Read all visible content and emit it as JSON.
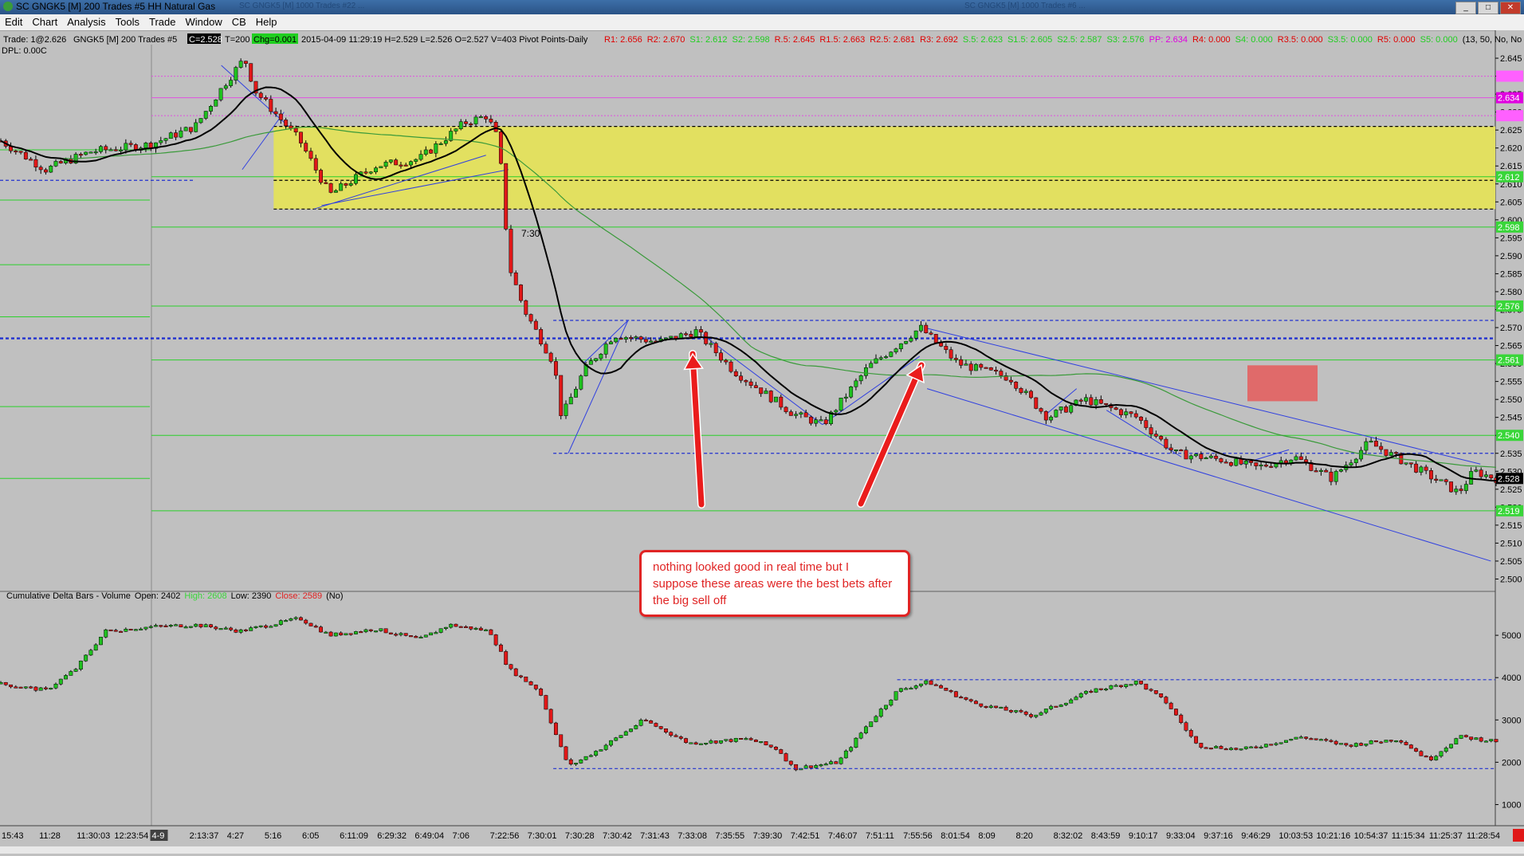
{
  "window": {
    "title": "SC GNGK5 [M]  200 Trades  #5  HH Natural Gas",
    "ghost_title_1": "SC  GNGK5 [M]  1000 Trades  #22 ...",
    "ghost_title_2": "SC  GNGK5 [M]  1000 Trades  #6 ...",
    "buttons": [
      "_",
      "□",
      "✕"
    ]
  },
  "menu": [
    "Edit",
    "Chart",
    "Analysis",
    "Tools",
    "Trade",
    "Window",
    "CB",
    "Help"
  ],
  "info_bar": {
    "trade": "Trade: 1@2.626",
    "symbol": "GNGK5 [M]  200 Trades  #5",
    "close_badge": "C=2.528",
    "t_label": "T=200",
    "chg_badge": "Chg=0.001",
    "bar_info": "2015-04-09 11:29:19 H=2.529 L=2.526 O=2.527 V=403 Pivot Points-Daily",
    "dpl": "DPL: 0.00C",
    "pivots": [
      {
        "text": "R1: 2.656",
        "color": "#e00000"
      },
      {
        "text": "R2: 2.670",
        "color": "#e00000"
      },
      {
        "text": "S1: 2.612",
        "color": "#1fcf1f"
      },
      {
        "text": "S2: 2.598",
        "color": "#1fcf1f"
      },
      {
        "text": "R.5: 2.645",
        "color": "#e00000"
      },
      {
        "text": "R1.5: 2.663",
        "color": "#e00000"
      },
      {
        "text": "R2.5: 2.681",
        "color": "#e00000"
      },
      {
        "text": "R3: 2.692",
        "color": "#e00000"
      },
      {
        "text": "S.5: 2.623",
        "color": "#1fcf1f"
      },
      {
        "text": "S1.5: 2.605",
        "color": "#1fcf1f"
      },
      {
        "text": "S2.5: 2.587",
        "color": "#1fcf1f"
      },
      {
        "text": "S3: 2.576",
        "color": "#1fcf1f"
      },
      {
        "text": "PP: 2.634",
        "color": "#e000e0"
      },
      {
        "text": "R4: 0.000",
        "color": "#e00000"
      },
      {
        "text": "S4: 0.000",
        "color": "#1fcf1f"
      },
      {
        "text": "R3.5: 0.000",
        "color": "#e00000"
      },
      {
        "text": "S3.5: 0.000",
        "color": "#1fcf1f"
      },
      {
        "text": "R5: 0.000",
        "color": "#e00000"
      },
      {
        "text": "S5: 0.000",
        "color": "#1fcf1f"
      },
      {
        "text": "(13, 50, No, No",
        "color": "#000000"
      }
    ]
  },
  "price_axis": {
    "ticks": [
      "2.645",
      "2.640",
      "2.635",
      "2.630",
      "2.625",
      "2.620",
      "2.615",
      "2.610",
      "2.605",
      "2.600",
      "2.595",
      "2.590",
      "2.585",
      "2.580",
      "2.575",
      "2.570",
      "2.565",
      "2.560",
      "2.555",
      "2.550",
      "2.545",
      "2.540",
      "2.535",
      "2.530",
      "2.525",
      "2.520",
      "2.515",
      "2.510",
      "2.505",
      "2.500"
    ],
    "tick_values": [
      2.645,
      2.64,
      2.635,
      2.63,
      2.625,
      2.62,
      2.615,
      2.61,
      2.605,
      2.6,
      2.595,
      2.59,
      2.585,
      2.58,
      2.575,
      2.57,
      2.565,
      2.56,
      2.555,
      2.55,
      2.545,
      2.54,
      2.535,
      2.53,
      2.525,
      2.52,
      2.515,
      2.51,
      2.505,
      2.5
    ],
    "labels": [
      {
        "value": 2.634,
        "text": "2.634",
        "color": "#e000e0"
      },
      {
        "value": 2.612,
        "text": "2.612",
        "color": "#39d639"
      },
      {
        "value": 2.598,
        "text": "2.598",
        "color": "#39d639"
      },
      {
        "value": 2.576,
        "text": "2.576",
        "color": "#39d639"
      },
      {
        "value": 2.561,
        "text": "2.561",
        "color": "#39d639"
      },
      {
        "value": 2.54,
        "text": "2.540",
        "color": "#39d639"
      },
      {
        "value": 2.528,
        "text": "2.528",
        "color": "#000000"
      },
      {
        "value": 2.519,
        "text": "2.519",
        "color": "#39d639"
      }
    ]
  },
  "price_levels": {
    "supply_zone": [
      2.603,
      2.626
    ],
    "green_pivots": [
      2.612,
      2.598,
      2.576,
      2.561,
      2.54,
      2.519
    ],
    "magenta_pivots": [
      2.634,
      2.64,
      2.629
    ],
    "blue_dash_lines": [
      {
        "value": 2.611,
        "x_from": 0.0,
        "x_to": 0.13
      },
      {
        "value": 2.572,
        "x_from": 0.37,
        "x_to": 1.0
      },
      {
        "value": 2.567,
        "x_from": 0.0,
        "x_to": 1.0
      },
      {
        "value": 2.535,
        "x_from": 0.37,
        "x_to": 1.0
      }
    ],
    "black_dash_lines": [
      2.626,
      2.611,
      2.603
    ]
  },
  "time_annotation": "7:30",
  "annotation": {
    "text": "nothing looked good in real time but I suppose these areas were the best bets after the big sell off"
  },
  "indicator": {
    "title": "Cumulative Delta Bars - Volume",
    "open": "Open: 2402",
    "high": "High: 2608",
    "low": "Low: 2390",
    "close": "Close: 2589",
    "no": "(No)",
    "axis_ticks": [
      "5000",
      "4000",
      "3000",
      "2000",
      "1000"
    ],
    "axis_values": [
      5000,
      4000,
      3000,
      2000,
      1000
    ],
    "dash_levels": [
      {
        "value": 3950,
        "x_from": 0.6,
        "x_to": 1.0
      },
      {
        "value": 1850,
        "x_from": 0.37,
        "x_to": 1.0
      }
    ]
  },
  "time_axis": {
    "labels": [
      "15:43",
      "11:28",
      "11:30:03",
      "12:23:54",
      "4-9",
      "2:13:37",
      "4:27",
      "5:16",
      "6:05",
      "6:11:09",
      "6:29:32",
      "6:49:04",
      "7:06",
      "7:22:56",
      "7:30:01",
      "7:30:28",
      "7:30:42",
      "7:31:43",
      "7:33:08",
      "7:35:55",
      "7:39:30",
      "7:42:51",
      "7:46:07",
      "7:51:11",
      "7:55:56",
      "8:01:54",
      "8:09",
      "8:20",
      "8:32:02",
      "8:43:59",
      "9:10:17",
      "9:33:04",
      "9:37:16",
      "9:46:29",
      "10:03:53",
      "10:21:16",
      "10:54:37",
      "11:15:34",
      "11:25:37",
      "11:28:54"
    ],
    "highlight": "4-9"
  },
  "chart_data": {
    "type": "candlestick",
    "price_key_points": [
      [
        0,
        2.622
      ],
      [
        0.03,
        2.614
      ],
      [
        0.06,
        2.619
      ],
      [
        0.1,
        2.621
      ],
      [
        0.13,
        2.626
      ],
      [
        0.15,
        2.638
      ],
      [
        0.163,
        2.645
      ],
      [
        0.17,
        2.636
      ],
      [
        0.2,
        2.622
      ],
      [
        0.22,
        2.607
      ],
      [
        0.25,
        2.615
      ],
      [
        0.28,
        2.617
      ],
      [
        0.31,
        2.627
      ],
      [
        0.325,
        2.629
      ],
      [
        0.333,
        2.622
      ],
      [
        0.34,
        2.587
      ],
      [
        0.35,
        2.575
      ],
      [
        0.37,
        2.56
      ],
      [
        0.375,
        2.545
      ],
      [
        0.39,
        2.558
      ],
      [
        0.41,
        2.568
      ],
      [
        0.44,
        2.566
      ],
      [
        0.465,
        2.569
      ],
      [
        0.49,
        2.558
      ],
      [
        0.53,
        2.546
      ],
      [
        0.55,
        2.543
      ],
      [
        0.58,
        2.559
      ],
      [
        0.615,
        2.57
      ],
      [
        0.64,
        2.56
      ],
      [
        0.675,
        2.556
      ],
      [
        0.7,
        2.545
      ],
      [
        0.725,
        2.55
      ],
      [
        0.76,
        2.545
      ],
      [
        0.785,
        2.535
      ],
      [
        0.82,
        2.533
      ],
      [
        0.84,
        2.531
      ],
      [
        0.865,
        2.534
      ],
      [
        0.89,
        2.528
      ],
      [
        0.915,
        2.538
      ],
      [
        0.95,
        2.53
      ],
      [
        0.975,
        2.524
      ],
      [
        0.985,
        2.53
      ],
      [
        1.0,
        2.528
      ]
    ],
    "delta_key_points": [
      [
        0,
        3850
      ],
      [
        0.03,
        3700
      ],
      [
        0.05,
        4200
      ],
      [
        0.07,
        5100
      ],
      [
        0.1,
        5200
      ],
      [
        0.13,
        5250
      ],
      [
        0.16,
        5100
      ],
      [
        0.18,
        5250
      ],
      [
        0.2,
        5400
      ],
      [
        0.22,
        5000
      ],
      [
        0.25,
        5150
      ],
      [
        0.28,
        4900
      ],
      [
        0.3,
        5250
      ],
      [
        0.327,
        5100
      ],
      [
        0.34,
        4200
      ],
      [
        0.36,
        3700
      ],
      [
        0.375,
        2300
      ],
      [
        0.38,
        1900
      ],
      [
        0.4,
        2300
      ],
      [
        0.43,
        3000
      ],
      [
        0.46,
        2450
      ],
      [
        0.5,
        2550
      ],
      [
        0.52,
        2300
      ],
      [
        0.53,
        1850
      ],
      [
        0.56,
        2000
      ],
      [
        0.58,
        2900
      ],
      [
        0.6,
        3700
      ],
      [
        0.62,
        3900
      ],
      [
        0.65,
        3400
      ],
      [
        0.69,
        3100
      ],
      [
        0.73,
        3700
      ],
      [
        0.76,
        3900
      ],
      [
        0.78,
        3400
      ],
      [
        0.8,
        2400
      ],
      [
        0.83,
        2300
      ],
      [
        0.87,
        2600
      ],
      [
        0.9,
        2400
      ],
      [
        0.935,
        2550
      ],
      [
        0.955,
        2050
      ],
      [
        0.975,
        2600
      ],
      [
        1.0,
        2500
      ]
    ],
    "price_ylim": [
      2.497,
      2.651
    ],
    "delta_ylim": [
      500,
      6000
    ]
  }
}
